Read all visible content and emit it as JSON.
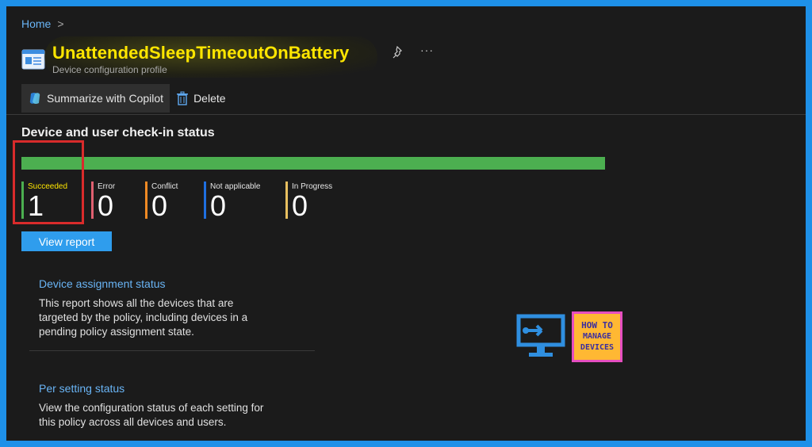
{
  "breadcrumb": {
    "home": "Home",
    "separator": ">"
  },
  "header": {
    "title": "UnattendedSleepTimeoutOnBattery",
    "subtitle": "Device configuration profile",
    "more": "···"
  },
  "toolbar": {
    "copilot_label": "Summarize with Copilot",
    "delete_label": "Delete"
  },
  "checkin": {
    "title": "Device and user check-in status",
    "progress_succeeded_fraction": 1.0,
    "statuses": [
      {
        "label": "Succeeded",
        "value": "1",
        "color": "#4caf50",
        "label_color": "#ffe600"
      },
      {
        "label": "Error",
        "value": "0",
        "color": "#e06070"
      },
      {
        "label": "Conflict",
        "value": "0",
        "color": "#f08a24"
      },
      {
        "label": "Not applicable",
        "value": "0",
        "color": "#1f6fe0"
      },
      {
        "label": "In Progress",
        "value": "0",
        "color": "#e8c060"
      }
    ],
    "view_report_label": "View report"
  },
  "cards": [
    {
      "title": "Device assignment status",
      "description": "This report shows all the devices that are targeted by the policy, including devices in a pending policy assignment state."
    },
    {
      "title": "Per setting status",
      "description": "View the configuration status of each setting for this policy across all devices and users."
    }
  ],
  "watermark": {
    "line1": "HOW TO",
    "line2": "MANAGE",
    "line3": "DEVICES"
  },
  "colors": {
    "accent": "#2f9ded",
    "link": "#69b4f5",
    "highlight_text": "#ffe600",
    "success": "#4caf50",
    "annotation": "#d92b2b"
  }
}
